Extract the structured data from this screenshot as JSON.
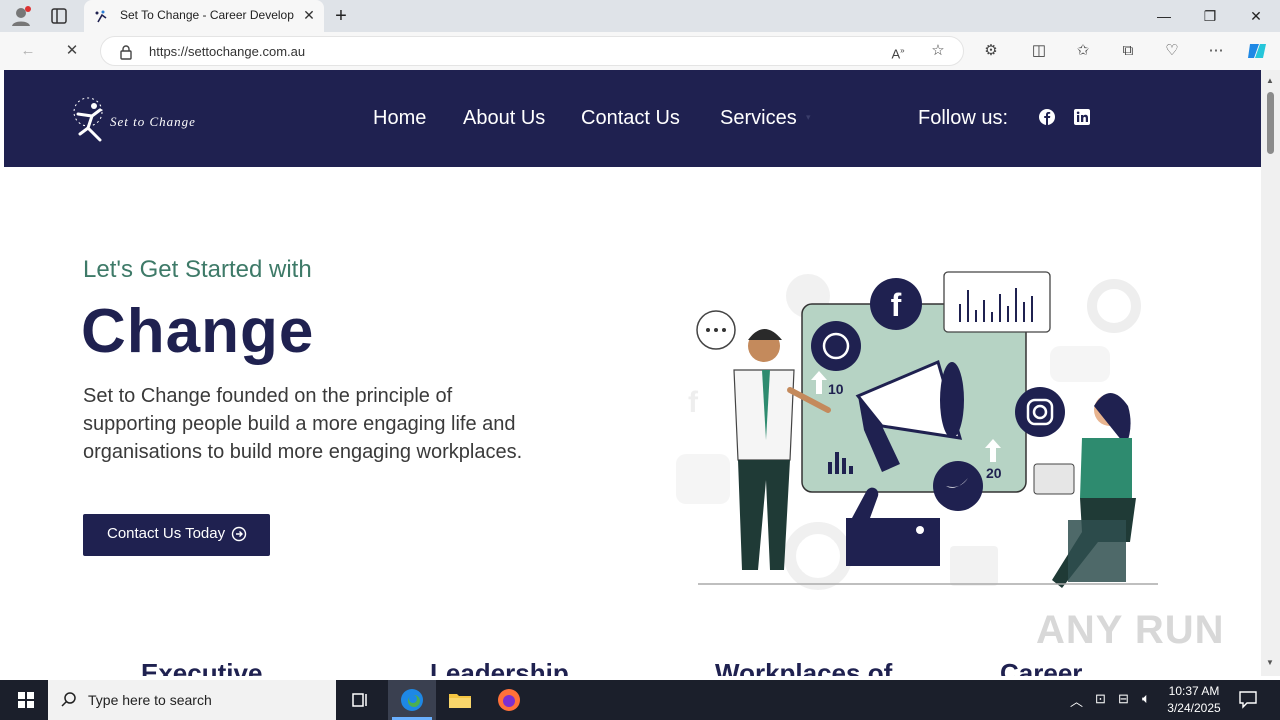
{
  "browser": {
    "tab_title": "Set To Change - Career Developm",
    "url": "https://settochange.com.au"
  },
  "site": {
    "logo_text": "Set to Change",
    "nav": [
      "Home",
      "About Us",
      "Contact Us",
      "Services"
    ],
    "follow_label": "Follow us:",
    "hero": {
      "eyebrow": "Let's Get Started with",
      "headline": "Change",
      "description": "Set to Change founded on the principle of supporting people build a more engaging life and organisations to build more engaging workplaces.",
      "cta_label": "Contact Us Today"
    },
    "illustration": {
      "count_left": "10",
      "count_right": "20"
    },
    "section_headings": [
      "Executive",
      "Leadership",
      "Workplaces of",
      "Career"
    ]
  },
  "watermark": "ANY RUN",
  "taskbar": {
    "search_placeholder": "Type here to search",
    "time": "10:37 AM",
    "date": "3/24/2025"
  },
  "colors": {
    "navy": "#1f2150",
    "teal": "#3e7a68",
    "mint": "#b6d3c4"
  }
}
